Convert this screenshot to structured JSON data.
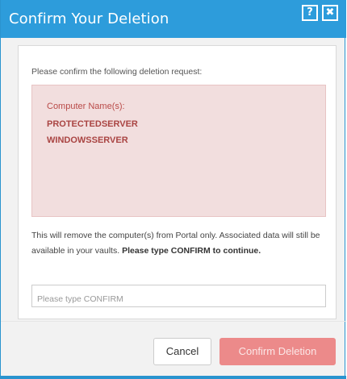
{
  "dialog": {
    "title": "Confirm Your Deletion",
    "help_label": "?",
    "close_label": "✖"
  },
  "content": {
    "prompt": "Please confirm the following deletion request:",
    "names_label": "Computer Name(s):",
    "computer_names": [
      "PROTECTEDSERVER",
      "WINDOWSSERVER"
    ],
    "info_prefix": "This will remove the computer(s) from Portal only. Associated data will still be available in your vaults. ",
    "info_bold": "Please type CONFIRM to continue.",
    "confirm_input": {
      "value": "",
      "placeholder": "Please type CONFIRM"
    }
  },
  "footer": {
    "cancel_label": "Cancel",
    "confirm_label": "Confirm Deletion"
  },
  "colors": {
    "titlebar": "#2d9cdb",
    "danger_box": "#f2dede",
    "danger_text": "#a94442",
    "confirm_button": "#ec8a8a"
  },
  "icons": {
    "help": "question-mark-icon",
    "close": "close-icon"
  }
}
